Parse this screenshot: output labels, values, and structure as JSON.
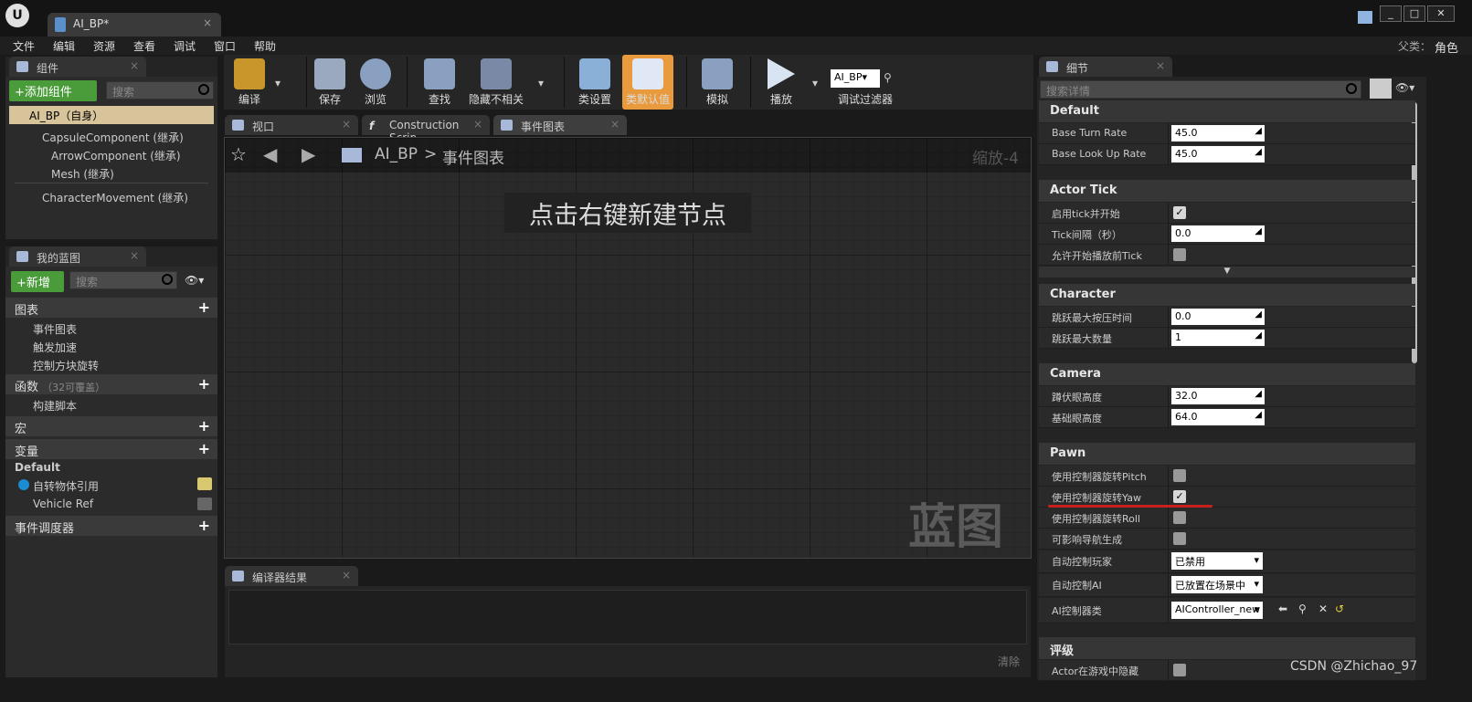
{
  "window": {
    "tab_title": "AI_BP*",
    "parent_label": "父类：",
    "parent_value": "角色"
  },
  "menu": [
    "文件",
    "编辑",
    "资源",
    "查看",
    "调试",
    "窗口",
    "帮助"
  ],
  "components": {
    "tab": "组件",
    "add_button": "+添加组件",
    "search_placeholder": "搜索",
    "root": "AI_BP（自身）",
    "items": [
      "CapsuleComponent (继承)",
      "ArrowComponent (继承)",
      "Mesh (继承)",
      "CharacterMovement (继承)"
    ]
  },
  "my_blueprint": {
    "tab": "我的蓝图",
    "new_button": "+新增",
    "search_placeholder": "搜索",
    "graphs_header": "图表",
    "graphs": [
      "事件图表",
      "触发加速",
      "控制方块旋转"
    ],
    "functions_header": "函数",
    "functions_note": "（32可覆盖）",
    "functions": [
      "构建脚本"
    ],
    "macros_header": "宏",
    "variables_header": "变量",
    "var_group": "Default",
    "variables": [
      "自转物体引用",
      "Vehicle Ref"
    ],
    "dispatchers_header": "事件调度器"
  },
  "toolbar": {
    "compile": "编译",
    "save": "保存",
    "browse": "浏览",
    "find": "查找",
    "hide_unrelated": "隐藏不相关",
    "class_settings": "类设置",
    "class_defaults": "类默认值",
    "simulate": "模拟",
    "play": "播放",
    "debug_object": "AI_BP",
    "debug_filter": "调试过滤器"
  },
  "editor_tabs": [
    "视口",
    "Construction Scrip",
    "事件图表"
  ],
  "graph": {
    "breadcrumb_bp": "AI_BP",
    "breadcrumb_sep": ">",
    "breadcrumb_graph": "事件图表",
    "zoom": "缩放-4",
    "hint": "点击右键新建节点",
    "watermark": "蓝图"
  },
  "compiler": {
    "tab": "编译器结果",
    "clear": "清除"
  },
  "details": {
    "tab": "细节",
    "search_placeholder": "搜索详情",
    "sections": {
      "default": "Default",
      "actor_tick": "Actor Tick",
      "character": "Character",
      "camera": "Camera",
      "pawn": "Pawn",
      "rating": "评级"
    },
    "base_turn_rate": {
      "label": "Base Turn Rate",
      "value": "45.0"
    },
    "base_look_up_rate": {
      "label": "Base Look Up Rate",
      "value": "45.0"
    },
    "tick_enable": {
      "label": "启用tick并开始",
      "checked": true
    },
    "tick_interval": {
      "label": "Tick间隔（秒）",
      "value": "0.0"
    },
    "tick_before_play": {
      "label": "允许开始播放前Tick",
      "checked": false
    },
    "jump_hold": {
      "label": "跳跃最大按压时间",
      "value": "0.0"
    },
    "jump_max": {
      "label": "跳跃最大数量",
      "value": "1"
    },
    "crouch_eye": {
      "label": "蹲伏眼高度",
      "value": "32.0"
    },
    "base_eye": {
      "label": "基础眼高度",
      "value": "64.0"
    },
    "use_pitch": {
      "label": "使用控制器旋转Pitch",
      "checked": false
    },
    "use_yaw": {
      "label": "使用控制器旋转Yaw",
      "checked": true
    },
    "use_roll": {
      "label": "使用控制器旋转Roll",
      "checked": false
    },
    "nav_affect": {
      "label": "可影响导航生成",
      "checked": false
    },
    "auto_possess_player": {
      "label": "自动控制玩家",
      "value": "已禁用"
    },
    "auto_possess_ai": {
      "label": "自动控制AI",
      "value": "已放置在场景中"
    },
    "ai_controller": {
      "label": "AI控制器类",
      "value": "AIController_new"
    },
    "hide_in_game": {
      "label": "Actor在游戏中隐藏",
      "checked": false
    }
  },
  "watermark": "CSDN @Zhichao_97"
}
